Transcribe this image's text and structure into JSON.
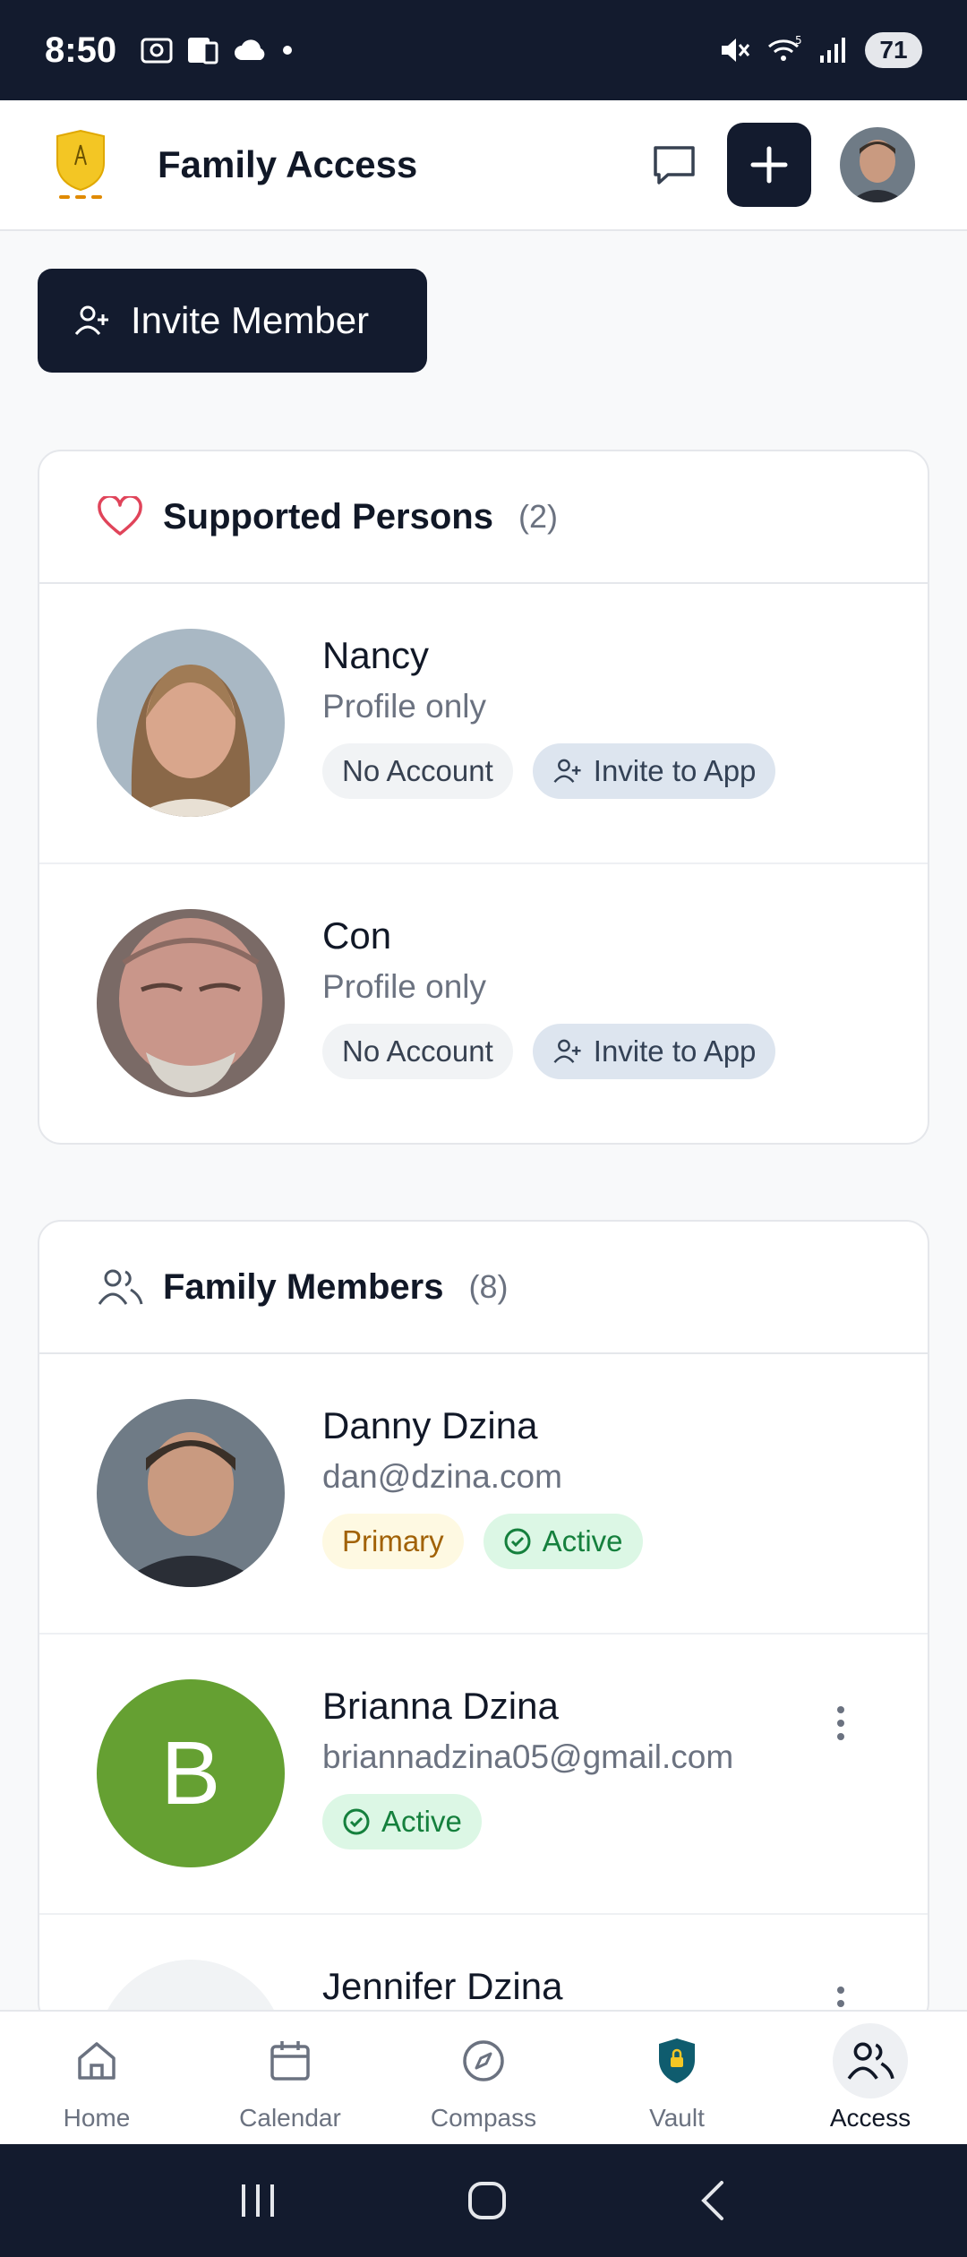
{
  "status_bar": {
    "time": "8:50",
    "battery": "71"
  },
  "header": {
    "title": "Family Access"
  },
  "invite_button": {
    "label": "Invite Member"
  },
  "supported": {
    "title": "Supported Persons",
    "count": "(2)",
    "people": [
      {
        "name": "Nancy",
        "subtitle": "Profile only",
        "badge": "No Account",
        "action": "Invite to App"
      },
      {
        "name": "Con",
        "subtitle": "Profile only",
        "badge": "No Account",
        "action": "Invite to App"
      }
    ]
  },
  "family": {
    "title": "Family Members",
    "count": "(8)",
    "members": [
      {
        "name": "Danny Dzina",
        "email": "dan@dzina.com",
        "role_badge": "Primary",
        "status": "Active"
      },
      {
        "name": "Brianna Dzina",
        "email": "briannadzina05@gmail.com",
        "status": "Active",
        "initial": "B",
        "avatar_color": "#65a032"
      },
      {
        "name": "Jennifer Dzina"
      }
    ]
  },
  "bottom_nav": {
    "items": [
      {
        "label": "Home",
        "icon": "home-icon"
      },
      {
        "label": "Calendar",
        "icon": "calendar-icon"
      },
      {
        "label": "Compass",
        "icon": "compass-icon"
      },
      {
        "label": "Vault",
        "icon": "vault-shield-icon"
      },
      {
        "label": "Access",
        "icon": "users-icon",
        "active": true
      }
    ]
  },
  "colors": {
    "primary": "#131b2e",
    "heart": "#e0445a",
    "vault": "#0f5c6e"
  }
}
